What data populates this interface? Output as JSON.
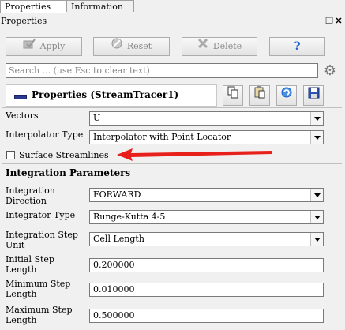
{
  "tabs": [
    {
      "label": "Properties",
      "active": true
    },
    {
      "label": "Information",
      "active": false
    }
  ],
  "panel": {
    "title": "Properties",
    "float_icon": "float-window-icon",
    "close_icon": "close-icon"
  },
  "toolbar": {
    "apply_label": "Apply",
    "reset_label": "Reset",
    "delete_label": "Delete",
    "help_label": "?"
  },
  "search": {
    "placeholder": "Search ... (use Esc to clear text)"
  },
  "properties_header": {
    "label": "Properties (StreamTracer1)",
    "buttons": [
      "copy-icon",
      "paste-icon",
      "refresh-icon",
      "save-icon"
    ]
  },
  "fields": {
    "vectors": {
      "label": "Vectors",
      "value": "U"
    },
    "interpolator_type": {
      "label": "Interpolator Type",
      "value": "Interpolator with Point Locator"
    },
    "surface_streamlines": {
      "label": "Surface Streamlines",
      "checked": false
    }
  },
  "integration": {
    "section_title": "Integration Parameters",
    "direction": {
      "label_line1": "Integration",
      "label_line2": "Direction",
      "value": "FORWARD"
    },
    "integrator_type": {
      "label": "Integrator Type",
      "value": "Runge-Kutta 4-5"
    },
    "step_unit": {
      "label_line1": "Integration Step",
      "label_line2": "Unit",
      "value": "Cell Length"
    },
    "initial_step": {
      "label_line1": "Initial Step",
      "label_line2": "Length",
      "value": "0.200000"
    },
    "minimum_step": {
      "label_line1": "Minimum Step",
      "label_line2": "Length",
      "value": "0.010000"
    },
    "maximum_step": {
      "label_line1": "Maximum Step",
      "label_line2": "Length",
      "value": "0.500000"
    }
  },
  "colors": {
    "annotation_arrow": "#e8201c",
    "help_icon": "#1e5fd0"
  }
}
